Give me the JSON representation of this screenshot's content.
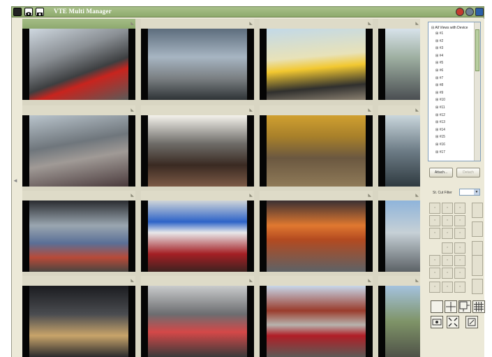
{
  "window": {
    "title": "VTE Multi Manager",
    "accent": "#95b176"
  },
  "titlebar_icons": [
    "grid-icon",
    "eye-icon",
    "camera-icon"
  ],
  "titlebar_buttons": [
    "help-icon",
    "settings-icon",
    "minimize-icon"
  ],
  "tree": {
    "root_label": "All Views with Device",
    "items": [
      "#1",
      "#2",
      "#3",
      "#4",
      "#5",
      "#6",
      "#7",
      "#8",
      "#9",
      "#10",
      "#11",
      "#12",
      "#13",
      "#14",
      "#15",
      "#16",
      "#17"
    ]
  },
  "buttons": {
    "attach": "Attach...",
    "detach": "Detach"
  },
  "filter": {
    "label": "St. Cut Filter"
  },
  "camera_grid": {
    "active_cell": 0
  }
}
